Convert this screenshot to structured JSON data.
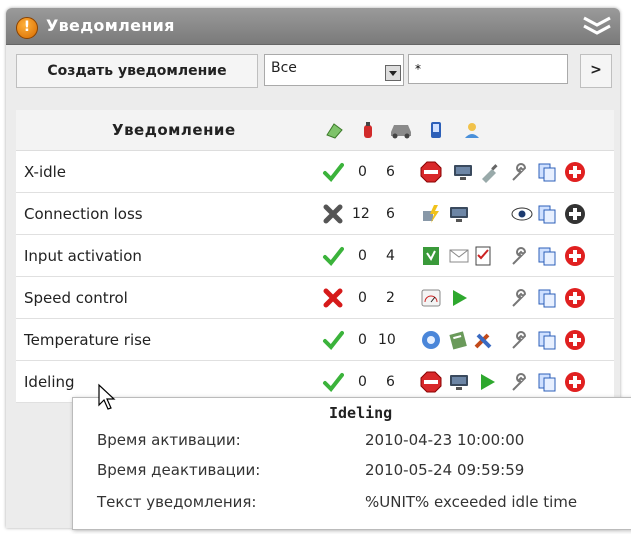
{
  "panel": {
    "title": "Уведомления"
  },
  "toolbar": {
    "create_label": "Создать уведомление",
    "filter_selected": "Все",
    "filter_text": "*",
    "next_label": ">"
  },
  "table": {
    "column_header": "Уведомление",
    "header_icons": [
      "trigger-icon",
      "fire-extinguisher-icon",
      "car-icon",
      "phone-icon",
      "users-icon"
    ],
    "rows": [
      {
        "name": "X-idle",
        "status": "active",
        "count": "0",
        "units": "6",
        "actions": [
          "stop-sign-icon",
          "monitor-icon",
          "plug-icon",
          "wrench-icon",
          "copy-icon",
          "delete-icon"
        ]
      },
      {
        "name": "Connection loss",
        "status": "disabled",
        "count": "12",
        "units": "6",
        "actions": [
          "plug-lightning-icon",
          "monitor-icon",
          "eye-icon",
          "copy-icon",
          "delete-icon"
        ]
      },
      {
        "name": "Input activation",
        "status": "active",
        "count": "0",
        "units": "4",
        "actions": [
          "document-icon",
          "envelope-icon",
          "checklist-icon",
          "wrench-icon",
          "copy-icon",
          "delete-icon"
        ]
      },
      {
        "name": "Speed control",
        "status": "inactive",
        "count": "0",
        "units": "2",
        "actions": [
          "speedometer-icon",
          "play-icon",
          "wrench-icon",
          "copy-icon",
          "delete-icon"
        ]
      },
      {
        "name": "Temperature rise",
        "status": "active",
        "count": "0",
        "units": "10",
        "actions": [
          "gear-icon",
          "chart-icon",
          "tools-icon",
          "wrench-icon",
          "copy-icon",
          "delete-icon"
        ]
      },
      {
        "name": "Ideling",
        "status": "active",
        "count": "0",
        "units": "6",
        "actions": [
          "stop-sign-icon",
          "monitor-icon",
          "play-icon",
          "wrench-icon",
          "copy-icon",
          "delete-icon"
        ]
      }
    ]
  },
  "tooltip": {
    "title": "Ideling",
    "activation_label": "Время активации:",
    "activation_value": "2010-04-23 10:00:00",
    "deactivation_label": "Время деактивации:",
    "deactivation_value": "2010-05-24 09:59:59",
    "text_label": "Текст уведомления:",
    "text_value": "%UNIT% exceeded idle time"
  },
  "colors": {
    "titlebar": "#8a8a8a",
    "active_check": "#3bb33b",
    "inactive_x": "#d61a1a",
    "delete_red": "#e02020"
  }
}
